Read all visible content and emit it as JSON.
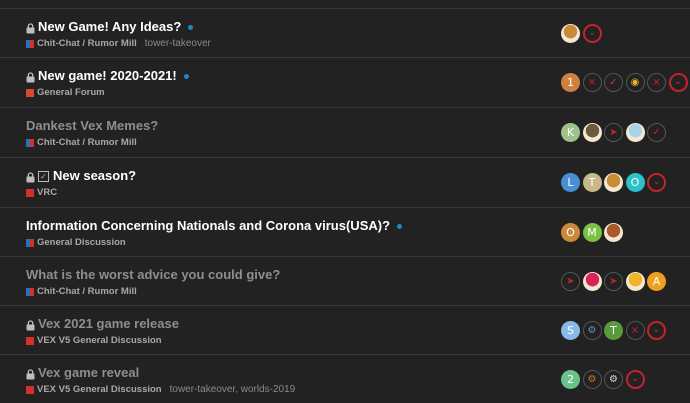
{
  "topics": [
    {
      "title": "New Game! Any Ideas?",
      "locked": true,
      "solved": false,
      "unread": true,
      "read": false,
      "category": "Chit-Chat / Rumor Mill",
      "cat_colors": [
        "#2f6fb5",
        "#d42f2f"
      ],
      "tags": "tower-takeover",
      "posters": [
        {
          "kind": "image",
          "color": "#c98a3a",
          "text": ""
        },
        {
          "kind": "chevron",
          "color": "#c4222e",
          "text": "⌄"
        }
      ]
    },
    {
      "title": "New game! 2020-2021!",
      "locked": true,
      "solved": false,
      "unread": true,
      "read": false,
      "category": "General Forum",
      "cat_colors": [
        "#d44a2a",
        "#d44a2a"
      ],
      "tags": "",
      "posters": [
        {
          "kind": "letter",
          "color": "#d1813e",
          "text": "1"
        },
        {
          "kind": "logo",
          "color": "#c4222e",
          "text": "⨯"
        },
        {
          "kind": "logo",
          "color": "#b04040",
          "text": "✓"
        },
        {
          "kind": "logo",
          "color": "#f0b428",
          "text": "◉"
        },
        {
          "kind": "logo",
          "color": "#c4222e",
          "text": "⨯"
        },
        {
          "kind": "chevron",
          "color": "#c4222e",
          "text": "⌄"
        }
      ]
    },
    {
      "title": "Dankest Vex Memes?",
      "locked": false,
      "solved": false,
      "unread": false,
      "read": true,
      "category": "Chit-Chat / Rumor Mill",
      "cat_colors": [
        "#2f6fb5",
        "#d42f2f"
      ],
      "tags": "",
      "posters": [
        {
          "kind": "letter",
          "color": "#9ec28a",
          "text": "K"
        },
        {
          "kind": "image",
          "color": "#6a5a40",
          "text": ""
        },
        {
          "kind": "logo",
          "color": "#c4222e",
          "text": "➤"
        },
        {
          "kind": "image",
          "color": "#a8d4e8",
          "text": ""
        },
        {
          "kind": "logo",
          "color": "#c4222e",
          "text": "✓"
        }
      ]
    },
    {
      "title": "New season?",
      "locked": true,
      "solved": true,
      "unread": false,
      "read": false,
      "category": "VRC",
      "cat_colors": [
        "#d42f2f",
        "#d42f2f"
      ],
      "tags": "",
      "posters": [
        {
          "kind": "letter",
          "color": "#4a8fd6",
          "text": "L"
        },
        {
          "kind": "letter",
          "color": "#c8b88a",
          "text": "T"
        },
        {
          "kind": "image",
          "color": "#c98a3a",
          "text": ""
        },
        {
          "kind": "letter",
          "color": "#2cc2c8",
          "text": "O"
        },
        {
          "kind": "chevron",
          "color": "#c4222e",
          "text": "⌄"
        }
      ]
    },
    {
      "title": "Information Concerning Nationals and Corona virus(USA)?",
      "locked": false,
      "solved": false,
      "unread": true,
      "read": false,
      "category": "General Discussion",
      "cat_colors": [
        "#2f6fb5",
        "#d42f2f"
      ],
      "tags": "",
      "posters": [
        {
          "kind": "letter",
          "color": "#c98a3a",
          "text": "O"
        },
        {
          "kind": "letter",
          "color": "#7ac243",
          "text": "M"
        },
        {
          "kind": "image",
          "color": "#a85a2a",
          "text": ""
        }
      ]
    },
    {
      "title": "What is the worst advice you could give?",
      "locked": false,
      "solved": false,
      "unread": false,
      "read": true,
      "category": "Chit-Chat / Rumor Mill",
      "cat_colors": [
        "#2f6fb5",
        "#d42f2f"
      ],
      "tags": "",
      "posters": [
        {
          "kind": "logo",
          "color": "#c4222e",
          "text": "➤"
        },
        {
          "kind": "image",
          "color": "#d8245a",
          "text": ""
        },
        {
          "kind": "logo",
          "color": "#c4222e",
          "text": "➤"
        },
        {
          "kind": "image",
          "color": "#f0b428",
          "text": ""
        },
        {
          "kind": "letter",
          "color": "#f0a020",
          "text": "A"
        }
      ]
    },
    {
      "title": "Vex 2021 game release",
      "locked": true,
      "solved": false,
      "unread": false,
      "read": true,
      "category": "VEX V5 General Discussion",
      "cat_colors": [
        "#d42f2f",
        "#d42f2f"
      ],
      "tags": "",
      "posters": [
        {
          "kind": "letter",
          "color": "#8ab8e8",
          "text": "S"
        },
        {
          "kind": "logo",
          "color": "#6a8ac8",
          "text": "⚙"
        },
        {
          "kind": "letter",
          "color": "#5a9a3a",
          "text": "T"
        },
        {
          "kind": "logo",
          "color": "#c4222e",
          "text": "⨯"
        },
        {
          "kind": "chevron",
          "color": "#c4222e",
          "text": "⌄"
        }
      ]
    },
    {
      "title": "Vex game reveal",
      "locked": true,
      "solved": false,
      "unread": false,
      "read": true,
      "category": "VEX V5 General Discussion",
      "cat_colors": [
        "#d42f2f",
        "#d42f2f"
      ],
      "tags": "tower-takeover, worlds-2019",
      "posters": [
        {
          "kind": "letter",
          "color": "#6ac28a",
          "text": "2"
        },
        {
          "kind": "logo",
          "color": "#d2781e",
          "text": "⚙"
        },
        {
          "kind": "logo",
          "color": "#dddddd",
          "text": "⚙"
        },
        {
          "kind": "chevron",
          "color": "#c4222e",
          "text": "⌄"
        }
      ]
    }
  ]
}
